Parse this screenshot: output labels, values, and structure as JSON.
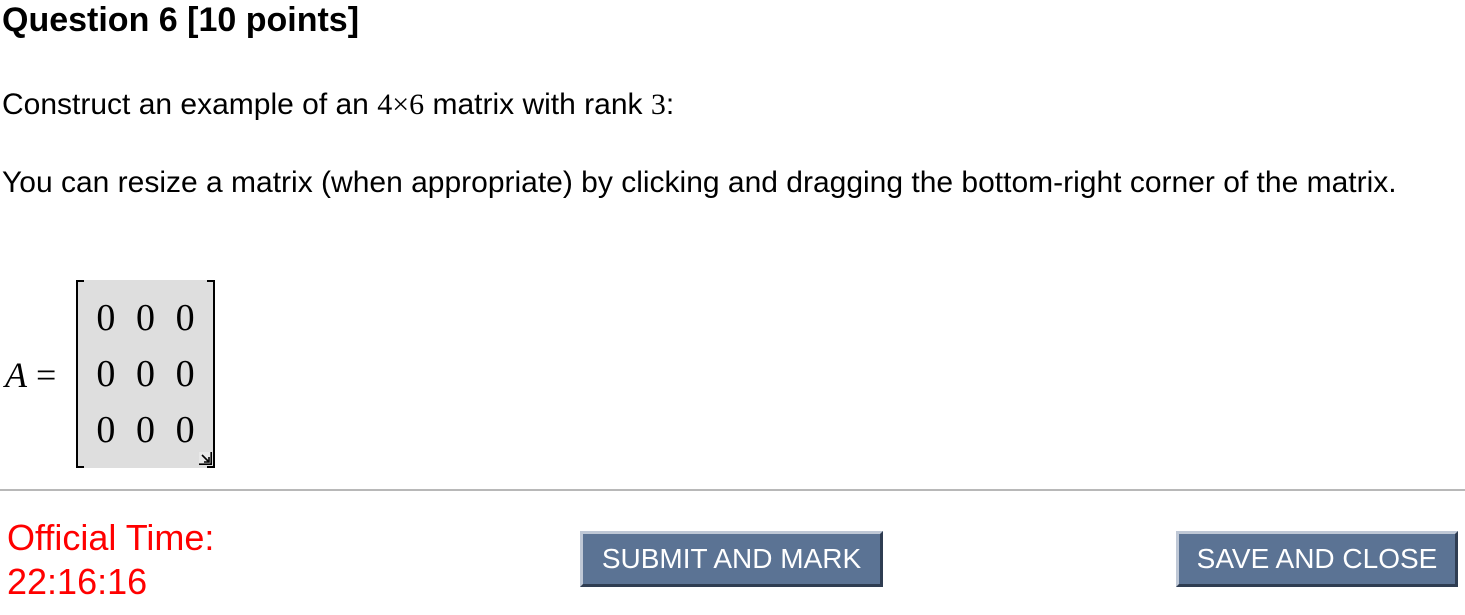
{
  "question": {
    "title": "Question 6 [10 points]",
    "prompt_before": "Construct an example of an ",
    "matrix_size": "4×6",
    "prompt_middle": " matrix with rank ",
    "rank": "3",
    "prompt_after": ":",
    "hint": "You can resize a matrix (when appropriate) by clicking and dragging the bottom-right corner of the matrix."
  },
  "matrix": {
    "variable": "A",
    "equals": "=",
    "rows": [
      [
        "0",
        "0",
        "0"
      ],
      [
        "0",
        "0",
        "0"
      ],
      [
        "0",
        "0",
        "0"
      ]
    ],
    "resize_icon": "resize-corner-icon"
  },
  "footer": {
    "time_label": "Official Time:",
    "time_value": "22:16:16",
    "time_color": "#ff0000",
    "submit_label": "SUBMIT AND MARK",
    "save_label": "SAVE AND CLOSE",
    "button_color": "#5b7394"
  }
}
